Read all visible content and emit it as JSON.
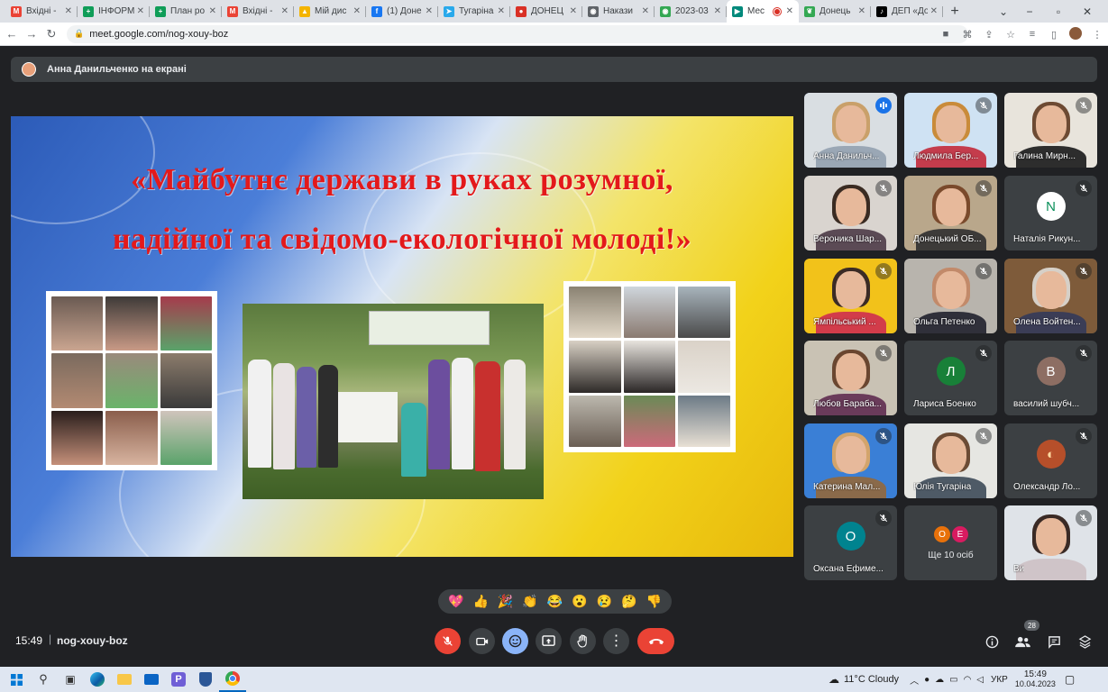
{
  "browser": {
    "tabs": [
      {
        "title": "Вхідні -",
        "icon": "gmail-icon",
        "color": "#ea4335",
        "glyph": "M"
      },
      {
        "title": "ІНФОРМ",
        "icon": "sheets-icon",
        "color": "#0f9d58",
        "glyph": "+"
      },
      {
        "title": "План ро",
        "icon": "sheets-icon",
        "color": "#0f9d58",
        "glyph": "+"
      },
      {
        "title": "Вхідні -",
        "icon": "gmail-icon",
        "color": "#ea4335",
        "glyph": "M"
      },
      {
        "title": "Мій дис",
        "icon": "drive-icon",
        "color": "#f4b400",
        "glyph": "▲"
      },
      {
        "title": "(1) Доне",
        "icon": "facebook-icon",
        "color": "#1877f2",
        "glyph": "f"
      },
      {
        "title": "Тугаріна",
        "icon": "telegram-icon",
        "color": "#29a9eb",
        "glyph": "➤"
      },
      {
        "title": "ДОНЕЦ",
        "icon": "pin-icon",
        "color": "#d93025",
        "glyph": "●"
      },
      {
        "title": "Накази",
        "icon": "site-icon",
        "color": "#5f6368",
        "glyph": "◉"
      },
      {
        "title": "2023-03",
        "icon": "site-icon",
        "color": "#34a853",
        "glyph": "◉"
      },
      {
        "title": "Мес",
        "icon": "meet-icon",
        "color": "#00897b",
        "glyph": "▶",
        "active": true
      },
      {
        "title": "Донець",
        "icon": "leaf-icon",
        "color": "#34a853",
        "glyph": "❦"
      },
      {
        "title": "ДЕП «До",
        "icon": "tiktok-icon",
        "color": "#000000",
        "glyph": "♪"
      }
    ],
    "new_tab": "+",
    "url": "meet.google.com/nog-xouy-boz"
  },
  "presenter": {
    "text": "Анна Данильченко на екрані"
  },
  "slide": {
    "title_line1": "«Майбутнє держави в руках розумної,",
    "title_line2": "надійної та свідомо-екологічної молоді!»"
  },
  "participants": [
    {
      "name": "Анна Данильч...",
      "speaking": true,
      "bg": "#d9dee2",
      "hair": "#c9a06a",
      "body": "#9aa7b5"
    },
    {
      "name": "Людмила Бер...",
      "bg": "#cfe2f3",
      "hair": "#c98b3a",
      "body": "#c43c4c"
    },
    {
      "name": "Галина Мирн...",
      "bg": "#e8e4dc",
      "hair": "#6d4a33",
      "body": "#2d2d2d"
    },
    {
      "name": "Вероника Шар...",
      "bg": "#d9d4cf",
      "hair": "#3a2b22",
      "body": "#5b4a55"
    },
    {
      "name": "Донецький ОБ...",
      "bg": "#b9a78b",
      "hair": "#7a4a2c",
      "body": "#3d3b39"
    },
    {
      "name": "Наталія Рикун...",
      "avatar": "N",
      "avatar_bg": "#ffffff",
      "avatar_fg": "#0a8f5a"
    },
    {
      "name": "Ямпільський ...",
      "bg": "#f2c21a",
      "hair": "#3b2b25",
      "body": "#d23c4a"
    },
    {
      "name": "Ольга Петенко",
      "bg": "#b8b4ad",
      "hair": "#c28a6a",
      "body": "#30303a"
    },
    {
      "name": "Олена Войтен...",
      "bg": "#7e5b3a",
      "hair": "#d6d0c8",
      "body": "#3b3d56"
    },
    {
      "name": "Любов Бараба...",
      "bg": "#c9c2b4",
      "hair": "#6a4630",
      "body": "#6a3b5a"
    },
    {
      "name": "Лариса Боенко",
      "avatar": "Л",
      "avatar_bg": "#188038",
      "avatar_fg": "#ffffff"
    },
    {
      "name": "василий шубч...",
      "avatar": "В",
      "avatar_bg": "#8d6e63",
      "avatar_fg": "#ffffff"
    },
    {
      "name": "Катерина Мал...",
      "bg": "#3a7fd6",
      "hair": "#d3a46b",
      "body": "#8a6a4a"
    },
    {
      "name": "Юлія Тугаріна",
      "bg": "#e6e6e2",
      "hair": "#6b4b35",
      "body": "#4e5a66"
    },
    {
      "name": "Олександр Ло...",
      "avatar": "◐",
      "avatar_bg": "#b64f2a",
      "avatar_fg": "#ffd9a0"
    },
    {
      "name": "Оксана Ефиме...",
      "avatar": "О",
      "avatar_bg": "#00838f",
      "avatar_fg": "#ffffff"
    },
    {
      "more": true,
      "text": "Ще 10 осіб",
      "avatars": [
        {
          "letter": "О",
          "color": "#e8710a"
        },
        {
          "letter": "Е",
          "color": "#d81b60"
        }
      ]
    },
    {
      "name": "Ви",
      "bg": "#dfe3e8",
      "hair": "#3a2a25",
      "body": "#cfc4c8"
    }
  ],
  "reactions": [
    "💖",
    "👍",
    "🎉",
    "👏",
    "😂",
    "😮",
    "😢",
    "🤔",
    "👎"
  ],
  "bottom": {
    "time": "15:49",
    "separator": "|",
    "meeting_code": "nog-xouy-boz",
    "participant_count": "28"
  },
  "taskbar": {
    "weather": "11°C  Cloudy",
    "lang": "УКР",
    "time": "15:49",
    "date": "10.04.2023"
  }
}
